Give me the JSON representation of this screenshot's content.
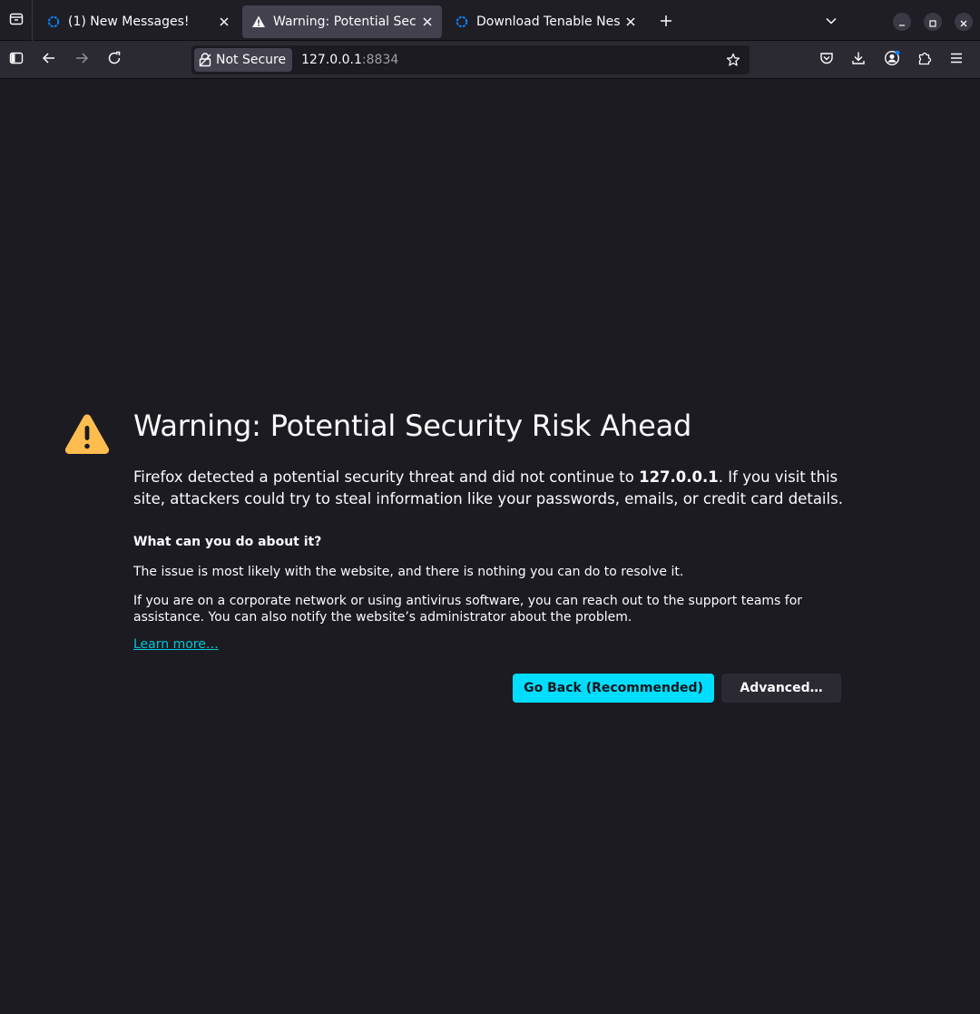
{
  "tabs": [
    {
      "title": "(1) New Messages!",
      "favicon": "loading-ring-icon",
      "active": false
    },
    {
      "title": "Warning: Potential Securi",
      "favicon": "warning-triangle-icon",
      "active": true
    },
    {
      "title": "Download Tenable Nessu",
      "favicon": "loading-ring-icon",
      "active": false
    }
  ],
  "urlbar": {
    "security_label": "Not Secure",
    "host": "127.0.0.1",
    "port": ":8834"
  },
  "page": {
    "title": "Warning: Potential Security Risk Ahead",
    "intro_before": "Firefox detected a potential security threat and did not continue to ",
    "intro_host": "127.0.0.1",
    "intro_after": ". If you visit this site, attackers could try to steal information like your passwords, emails, or credit card details.",
    "what_heading": "What can you do about it?",
    "paragraph1": "The issue is most likely with the website, and there is nothing you can do to resolve it.",
    "paragraph2": "If you are on a corporate network or using antivirus software, you can reach out to the support teams for assistance. You can also notify the website’s administrator about the problem.",
    "learn_more": "Learn more…",
    "go_back_label": "Go Back (Recommended)",
    "advanced_label": "Advanced…"
  },
  "colors": {
    "background": "#1c1b22",
    "accent": "#00ddff",
    "link": "#00c8d7",
    "warning": "#ffbd4f"
  }
}
